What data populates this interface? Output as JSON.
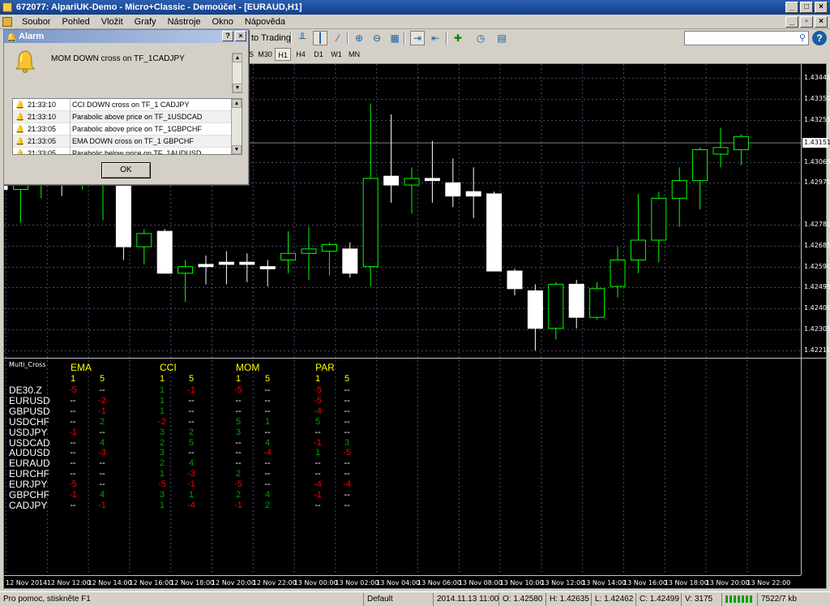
{
  "window": {
    "title": "672077: AlpariUK-Demo - Micro+Classic - Demoúčet - [EURAUD,H1]"
  },
  "menu": [
    "Soubor",
    "Pohled",
    "Vložit",
    "Grafy",
    "Nástroje",
    "Okno",
    "Nápověda"
  ],
  "toolbar": {
    "autotrading_label": "to Trading",
    "search_placeholder": ""
  },
  "timeframes": [
    "S",
    "M30",
    "H1",
    "H4",
    "D1",
    "W1",
    "MN"
  ],
  "active_timeframe": "H1",
  "alarm": {
    "title": "Alarm",
    "message": "MOM DOWN cross on TF_1CADJPY",
    "rows": [
      {
        "time": "21:33:10",
        "text": "CCI DOWN cross on TF_1 CADJPY"
      },
      {
        "time": "21:33:10",
        "text": "Parabolic above price on TF_1USDCAD"
      },
      {
        "time": "21:33:05",
        "text": "Parabolic above price on TF_1GBPCHF"
      },
      {
        "time": "21:33:05",
        "text": "EMA DOWN cross on TF_1 GBPCHF"
      },
      {
        "time": "21:33:05",
        "text": "Parabolic below price on TF_1AUDUSD"
      }
    ],
    "ok_label": "OK"
  },
  "chart": {
    "symbol": "EURAUD,H1",
    "price_labels": [
      "1.43445",
      "1.43350",
      "1.43255",
      "1.43065",
      "1.42970",
      "1.42780",
      "1.42685",
      "1.42590",
      "1.42495",
      "1.42400",
      "1.42305",
      "1.42210"
    ],
    "current_price": "1.43151",
    "time_labels": [
      "12 Nov 2014",
      "12 Nov 12:00",
      "12 Nov 14:00",
      "12 Nov 16:00",
      "12 Nov 18:00",
      "12 Nov 20:00",
      "12 Nov 22:00",
      "13 Nov 00:00",
      "13 Nov 02:00",
      "13 Nov 04:00",
      "13 Nov 06:00",
      "13 Nov 08:00",
      "13 Nov 10:00",
      "13 Nov 12:00",
      "13 Nov 14:00",
      "13 Nov 16:00",
      "13 Nov 18:00",
      "13 Nov 20:00",
      "13 Nov 22:00"
    ],
    "colors": {
      "bull": "#00ff00",
      "bear": "#ffffff",
      "grid": "#4a4a6a"
    }
  },
  "chart_data": {
    "type": "candlestick",
    "ylim": [
      1.42195,
      1.4349
    ],
    "candles": [
      {
        "o": 1.43,
        "h": 1.4306,
        "l": 1.4288,
        "c": 1.4294
      },
      {
        "o": 1.4294,
        "h": 1.4301,
        "l": 1.4279,
        "c": 1.4298
      },
      {
        "o": 1.4298,
        "h": 1.4303,
        "l": 1.429,
        "c": 1.43
      },
      {
        "o": 1.43,
        "h": 1.4304,
        "l": 1.4291,
        "c": 1.4297
      },
      {
        "o": 1.4297,
        "h": 1.4302,
        "l": 1.4294,
        "c": 1.43
      },
      {
        "o": 1.43,
        "h": 1.4302,
        "l": 1.428,
        "c": 1.43
      },
      {
        "o": 1.43,
        "h": 1.4304,
        "l": 1.4262,
        "c": 1.4268
      },
      {
        "o": 1.4268,
        "h": 1.4276,
        "l": 1.426,
        "c": 1.4274
      },
      {
        "o": 1.4275,
        "h": 1.4276,
        "l": 1.4256,
        "c": 1.4256
      },
      {
        "o": 1.4256,
        "h": 1.4262,
        "l": 1.4243,
        "c": 1.4259
      },
      {
        "o": 1.426,
        "h": 1.4264,
        "l": 1.4251,
        "c": 1.4259
      },
      {
        "o": 1.4261,
        "h": 1.4266,
        "l": 1.4251,
        "c": 1.426
      },
      {
        "o": 1.4261,
        "h": 1.4265,
        "l": 1.4252,
        "c": 1.426
      },
      {
        "o": 1.4259,
        "h": 1.4262,
        "l": 1.425,
        "c": 1.4258
      },
      {
        "o": 1.4262,
        "h": 1.4275,
        "l": 1.4256,
        "c": 1.4265
      },
      {
        "o": 1.4265,
        "h": 1.4277,
        "l": 1.4253,
        "c": 1.4267
      },
      {
        "o": 1.4266,
        "h": 1.427,
        "l": 1.4255,
        "c": 1.4269
      },
      {
        "o": 1.4267,
        "h": 1.427,
        "l": 1.4254,
        "c": 1.4256
      },
      {
        "o": 1.4259,
        "h": 1.4333,
        "l": 1.425,
        "c": 1.4299
      },
      {
        "o": 1.43,
        "h": 1.4328,
        "l": 1.4288,
        "c": 1.4296
      },
      {
        "o": 1.4296,
        "h": 1.4304,
        "l": 1.4283,
        "c": 1.4299
      },
      {
        "o": 1.4299,
        "h": 1.4316,
        "l": 1.4288,
        "c": 1.4298
      },
      {
        "o": 1.4297,
        "h": 1.4308,
        "l": 1.4286,
        "c": 1.4291
      },
      {
        "o": 1.4293,
        "h": 1.4304,
        "l": 1.4281,
        "c": 1.4291
      },
      {
        "o": 1.4292,
        "h": 1.4293,
        "l": 1.4257,
        "c": 1.4257
      },
      {
        "o": 1.4257,
        "h": 1.4258,
        "l": 1.4246,
        "c": 1.4249
      },
      {
        "o": 1.4248,
        "h": 1.4251,
        "l": 1.4221,
        "c": 1.4231
      },
      {
        "o": 1.4231,
        "h": 1.4252,
        "l": 1.4226,
        "c": 1.4251
      },
      {
        "o": 1.4251,
        "h": 1.4253,
        "l": 1.4231,
        "c": 1.4236
      },
      {
        "o": 1.4236,
        "h": 1.4252,
        "l": 1.4235,
        "c": 1.4249
      },
      {
        "o": 1.425,
        "h": 1.4268,
        "l": 1.4245,
        "c": 1.4262
      },
      {
        "o": 1.4262,
        "h": 1.4292,
        "l": 1.4256,
        "c": 1.4271
      },
      {
        "o": 1.4271,
        "h": 1.4293,
        "l": 1.4261,
        "c": 1.429
      },
      {
        "o": 1.429,
        "h": 1.4304,
        "l": 1.4277,
        "c": 1.4298
      },
      {
        "o": 1.4298,
        "h": 1.4313,
        "l": 1.4285,
        "c": 1.4312
      },
      {
        "o": 1.431,
        "h": 1.4322,
        "l": 1.4304,
        "c": 1.4313
      },
      {
        "o": 1.4312,
        "h": 1.4319,
        "l": 1.4305,
        "c": 1.4318
      }
    ]
  },
  "multi_cross": {
    "name": "Multi_Cross",
    "groups": [
      "EMA",
      "CCI",
      "MOM",
      "PAR"
    ],
    "periods": [
      "1",
      "5"
    ],
    "colors": {
      "up": "#00a000",
      "down": "#ff0000",
      "none": "#ffffff"
    },
    "rows": [
      {
        "symbol": "DE30.Z",
        "cells": [
          "-5",
          "--",
          "1",
          "-1",
          "-5",
          "--",
          "-5",
          "--"
        ]
      },
      {
        "symbol": "EURUSD",
        "cells": [
          "--",
          "-2",
          "1",
          "--",
          "--",
          "--",
          "-5",
          "--"
        ]
      },
      {
        "symbol": "GBPUSD",
        "cells": [
          "--",
          "-1",
          "1",
          "--",
          "--",
          "--",
          "-4",
          "--"
        ]
      },
      {
        "symbol": "USDCHF",
        "cells": [
          "--",
          "2",
          "-2",
          "--",
          "5",
          "1",
          "5",
          "--"
        ]
      },
      {
        "symbol": "USDJPY",
        "cells": [
          "-1",
          "--",
          "3",
          "2",
          "3",
          "--",
          "--",
          "--"
        ]
      },
      {
        "symbol": "USDCAD",
        "cells": [
          "--",
          "4",
          "2",
          "5",
          "--",
          "4",
          "-1",
          "3"
        ]
      },
      {
        "symbol": "AUDUSD",
        "cells": [
          "--",
          "-3",
          "3",
          "--",
          "--",
          "-4",
          "1",
          "-5"
        ]
      },
      {
        "symbol": "EURAUD",
        "cells": [
          "--",
          "--",
          "2",
          "4",
          "--",
          "--",
          "--",
          "--"
        ]
      },
      {
        "symbol": "EURCHF",
        "cells": [
          "--",
          "--",
          "1",
          "-3",
          "2",
          "--",
          "--",
          "--"
        ]
      },
      {
        "symbol": "EURJPY",
        "cells": [
          "-5",
          "--",
          "-5",
          "-1",
          "-5",
          "--",
          "-4",
          "-4"
        ]
      },
      {
        "symbol": "GBPCHF",
        "cells": [
          "-1",
          "4",
          "3",
          "1",
          "2",
          "4",
          "-1",
          "--"
        ]
      },
      {
        "symbol": "CADJPY",
        "cells": [
          "--",
          "-1",
          "1",
          "-4",
          "-1",
          "2",
          "--",
          "--"
        ]
      }
    ]
  },
  "statusbar": {
    "help": "Pro pomoc, stiskněte F1",
    "profile": "Default",
    "datetime": "2014.11.13 11:00",
    "open": "O: 1.42580",
    "high": "H: 1.42635",
    "low": "L: 1.42462",
    "close": "C: 1.42499",
    "volume": "V: 3175",
    "traffic": "7522/7 kb"
  }
}
